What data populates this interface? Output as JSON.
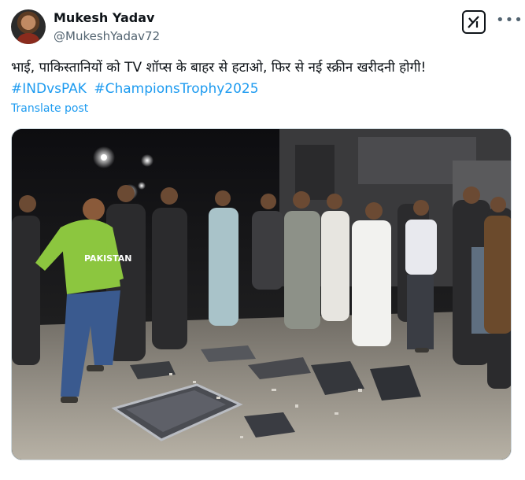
{
  "author": {
    "name": "Mukesh Yadav",
    "handle": "@MukeshYadav72"
  },
  "post": {
    "text": "भाई, पाकिस्तानियों को TV शॉप्स के बाहर से हटाओ, फिर से नई स्क्रीन खरीदनी होगी!",
    "hashtags": [
      "#INDvsPAK",
      "#ChampionsTrophy2025"
    ],
    "translate_label": "Translate post"
  },
  "media": {
    "shirt_text": "PAKISTAN"
  },
  "icons": {
    "grok": "grok-icon",
    "more": "more-icon"
  },
  "colors": {
    "link": "#1d9bf0",
    "text": "#0f1419",
    "secondary": "#536471",
    "shirt_green": "#8cc63f"
  }
}
